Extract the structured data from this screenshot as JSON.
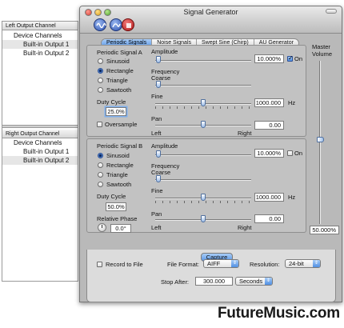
{
  "output_panels": {
    "left": {
      "title": "Left Output Channel",
      "header": "Device Channels",
      "items": [
        "Built-in Output 1",
        "Built-in Output 2"
      ],
      "selected_index": 0
    },
    "right": {
      "title": "Right Output Channel",
      "header": "Device Channels",
      "items": [
        "Built-in Output 1",
        "Built-in Output 2"
      ],
      "selected_index": 1
    }
  },
  "window": {
    "title": "Signal Generator",
    "toolbar_icons": [
      "periodic-signal-icon",
      "chirp-icon",
      "stop-icon"
    ]
  },
  "tabs": [
    {
      "label": "Periodic Signals",
      "active": true
    },
    {
      "label": "Noise Signals",
      "active": false
    },
    {
      "label": "Swept Sine (Chirp)",
      "active": false
    },
    {
      "label": "AU Generator",
      "active": false
    }
  ],
  "signal_a": {
    "title": "Periodic Signal A",
    "waveforms": [
      "Sinusoid",
      "Rectangle",
      "Triangle",
      "Sawtooth"
    ],
    "selected_waveform": "Rectangle",
    "duty_cycle_label": "Duty Cycle",
    "duty_cycle_value": "25.0%",
    "oversample_label": "Oversample",
    "oversample_checked": false,
    "amplitude_label": "Amplitude",
    "amplitude_value": "10.000%",
    "on_label": "On",
    "on_checked": true,
    "frequency_label": "Frequency",
    "coarse_label": "Coarse",
    "fine_label": "Fine",
    "frequency_value": "1000.000",
    "hz_label": "Hz",
    "pan_label": "Pan",
    "pan_value": "0.00",
    "left_label": "Left",
    "right_label": "Right"
  },
  "signal_b": {
    "title": "Periodic Signal B",
    "waveforms": [
      "Sinusoid",
      "Rectangle",
      "Triangle",
      "Sawtooth"
    ],
    "selected_waveform": "Sinusoid",
    "duty_cycle_label": "Duty Cycle",
    "duty_cycle_value": "50.0%",
    "relative_phase_label": "Relative Phase",
    "relative_phase_value": "0.0°",
    "amplitude_label": "Amplitude",
    "amplitude_value": "10.000%",
    "on_label": "On",
    "on_checked": false,
    "frequency_label": "Frequency",
    "coarse_label": "Coarse",
    "fine_label": "Fine",
    "frequency_value": "1000.000",
    "hz_label": "Hz",
    "pan_label": "Pan",
    "pan_value": "0.00",
    "left_label": "Left",
    "right_label": "Right"
  },
  "master": {
    "label_line1": "Master",
    "label_line2": "Volume",
    "value": "50.000%"
  },
  "capture": {
    "button_label": "Capture",
    "record_label": "Record to File",
    "record_checked": false,
    "file_format_label": "File Format:",
    "file_format_value": "AIFF",
    "resolution_label": "Resolution:",
    "resolution_value": "24-bit",
    "stop_after_label": "Stop After:",
    "stop_after_value": "300.000",
    "stop_after_unit": "Seconds"
  },
  "watermark": "FutureMusic.com"
}
